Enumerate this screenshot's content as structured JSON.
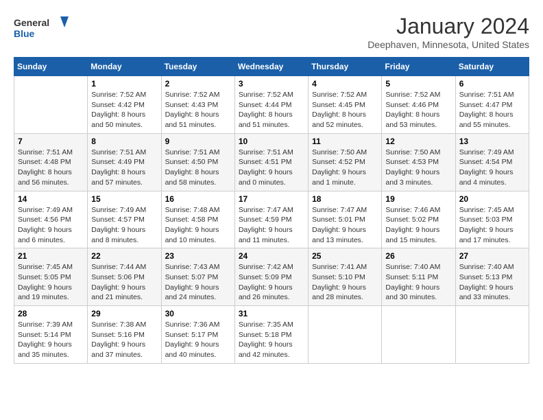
{
  "logo": {
    "general": "General",
    "blue": "Blue"
  },
  "header": {
    "month": "January 2024",
    "location": "Deephaven, Minnesota, United States"
  },
  "weekdays": [
    "Sunday",
    "Monday",
    "Tuesday",
    "Wednesday",
    "Thursday",
    "Friday",
    "Saturday"
  ],
  "weeks": [
    [
      {
        "day": "",
        "sunrise": "",
        "sunset": "",
        "daylight": ""
      },
      {
        "day": "1",
        "sunrise": "Sunrise: 7:52 AM",
        "sunset": "Sunset: 4:42 PM",
        "daylight": "Daylight: 8 hours and 50 minutes."
      },
      {
        "day": "2",
        "sunrise": "Sunrise: 7:52 AM",
        "sunset": "Sunset: 4:43 PM",
        "daylight": "Daylight: 8 hours and 51 minutes."
      },
      {
        "day": "3",
        "sunrise": "Sunrise: 7:52 AM",
        "sunset": "Sunset: 4:44 PM",
        "daylight": "Daylight: 8 hours and 51 minutes."
      },
      {
        "day": "4",
        "sunrise": "Sunrise: 7:52 AM",
        "sunset": "Sunset: 4:45 PM",
        "daylight": "Daylight: 8 hours and 52 minutes."
      },
      {
        "day": "5",
        "sunrise": "Sunrise: 7:52 AM",
        "sunset": "Sunset: 4:46 PM",
        "daylight": "Daylight: 8 hours and 53 minutes."
      },
      {
        "day": "6",
        "sunrise": "Sunrise: 7:51 AM",
        "sunset": "Sunset: 4:47 PM",
        "daylight": "Daylight: 8 hours and 55 minutes."
      }
    ],
    [
      {
        "day": "7",
        "sunrise": "Sunrise: 7:51 AM",
        "sunset": "Sunset: 4:48 PM",
        "daylight": "Daylight: 8 hours and 56 minutes."
      },
      {
        "day": "8",
        "sunrise": "Sunrise: 7:51 AM",
        "sunset": "Sunset: 4:49 PM",
        "daylight": "Daylight: 8 hours and 57 minutes."
      },
      {
        "day": "9",
        "sunrise": "Sunrise: 7:51 AM",
        "sunset": "Sunset: 4:50 PM",
        "daylight": "Daylight: 8 hours and 58 minutes."
      },
      {
        "day": "10",
        "sunrise": "Sunrise: 7:51 AM",
        "sunset": "Sunset: 4:51 PM",
        "daylight": "Daylight: 9 hours and 0 minutes."
      },
      {
        "day": "11",
        "sunrise": "Sunrise: 7:50 AM",
        "sunset": "Sunset: 4:52 PM",
        "daylight": "Daylight: 9 hours and 1 minute."
      },
      {
        "day": "12",
        "sunrise": "Sunrise: 7:50 AM",
        "sunset": "Sunset: 4:53 PM",
        "daylight": "Daylight: 9 hours and 3 minutes."
      },
      {
        "day": "13",
        "sunrise": "Sunrise: 7:49 AM",
        "sunset": "Sunset: 4:54 PM",
        "daylight": "Daylight: 9 hours and 4 minutes."
      }
    ],
    [
      {
        "day": "14",
        "sunrise": "Sunrise: 7:49 AM",
        "sunset": "Sunset: 4:56 PM",
        "daylight": "Daylight: 9 hours and 6 minutes."
      },
      {
        "day": "15",
        "sunrise": "Sunrise: 7:49 AM",
        "sunset": "Sunset: 4:57 PM",
        "daylight": "Daylight: 9 hours and 8 minutes."
      },
      {
        "day": "16",
        "sunrise": "Sunrise: 7:48 AM",
        "sunset": "Sunset: 4:58 PM",
        "daylight": "Daylight: 9 hours and 10 minutes."
      },
      {
        "day": "17",
        "sunrise": "Sunrise: 7:47 AM",
        "sunset": "Sunset: 4:59 PM",
        "daylight": "Daylight: 9 hours and 11 minutes."
      },
      {
        "day": "18",
        "sunrise": "Sunrise: 7:47 AM",
        "sunset": "Sunset: 5:01 PM",
        "daylight": "Daylight: 9 hours and 13 minutes."
      },
      {
        "day": "19",
        "sunrise": "Sunrise: 7:46 AM",
        "sunset": "Sunset: 5:02 PM",
        "daylight": "Daylight: 9 hours and 15 minutes."
      },
      {
        "day": "20",
        "sunrise": "Sunrise: 7:45 AM",
        "sunset": "Sunset: 5:03 PM",
        "daylight": "Daylight: 9 hours and 17 minutes."
      }
    ],
    [
      {
        "day": "21",
        "sunrise": "Sunrise: 7:45 AM",
        "sunset": "Sunset: 5:05 PM",
        "daylight": "Daylight: 9 hours and 19 minutes."
      },
      {
        "day": "22",
        "sunrise": "Sunrise: 7:44 AM",
        "sunset": "Sunset: 5:06 PM",
        "daylight": "Daylight: 9 hours and 21 minutes."
      },
      {
        "day": "23",
        "sunrise": "Sunrise: 7:43 AM",
        "sunset": "Sunset: 5:07 PM",
        "daylight": "Daylight: 9 hours and 24 minutes."
      },
      {
        "day": "24",
        "sunrise": "Sunrise: 7:42 AM",
        "sunset": "Sunset: 5:09 PM",
        "daylight": "Daylight: 9 hours and 26 minutes."
      },
      {
        "day": "25",
        "sunrise": "Sunrise: 7:41 AM",
        "sunset": "Sunset: 5:10 PM",
        "daylight": "Daylight: 9 hours and 28 minutes."
      },
      {
        "day": "26",
        "sunrise": "Sunrise: 7:40 AM",
        "sunset": "Sunset: 5:11 PM",
        "daylight": "Daylight: 9 hours and 30 minutes."
      },
      {
        "day": "27",
        "sunrise": "Sunrise: 7:40 AM",
        "sunset": "Sunset: 5:13 PM",
        "daylight": "Daylight: 9 hours and 33 minutes."
      }
    ],
    [
      {
        "day": "28",
        "sunrise": "Sunrise: 7:39 AM",
        "sunset": "Sunset: 5:14 PM",
        "daylight": "Daylight: 9 hours and 35 minutes."
      },
      {
        "day": "29",
        "sunrise": "Sunrise: 7:38 AM",
        "sunset": "Sunset: 5:16 PM",
        "daylight": "Daylight: 9 hours and 37 minutes."
      },
      {
        "day": "30",
        "sunrise": "Sunrise: 7:36 AM",
        "sunset": "Sunset: 5:17 PM",
        "daylight": "Daylight: 9 hours and 40 minutes."
      },
      {
        "day": "31",
        "sunrise": "Sunrise: 7:35 AM",
        "sunset": "Sunset: 5:18 PM",
        "daylight": "Daylight: 9 hours and 42 minutes."
      },
      {
        "day": "",
        "sunrise": "",
        "sunset": "",
        "daylight": ""
      },
      {
        "day": "",
        "sunrise": "",
        "sunset": "",
        "daylight": ""
      },
      {
        "day": "",
        "sunrise": "",
        "sunset": "",
        "daylight": ""
      }
    ]
  ]
}
